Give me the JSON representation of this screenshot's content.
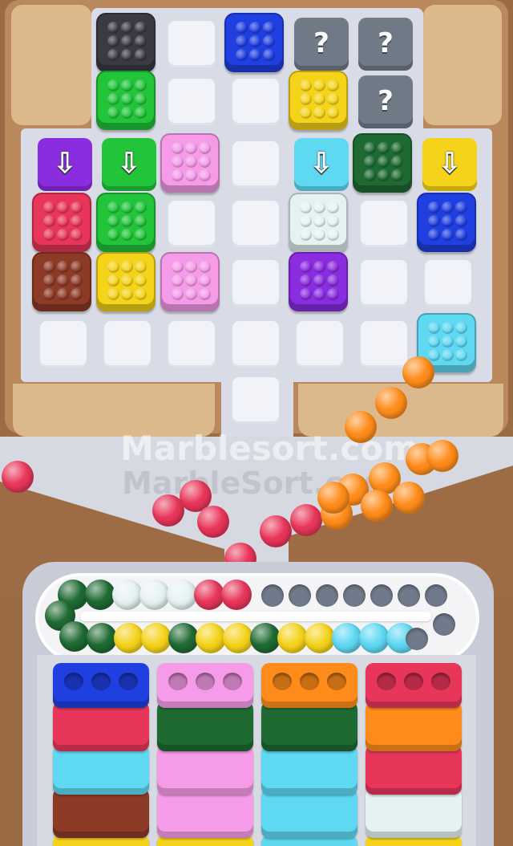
{
  "game_title": "Marble Sort",
  "watermark_primary": "Marblesort.com",
  "watermark_secondary": "MarbleSort.com",
  "hidden_block_symbol": "?",
  "release_arrow_symbol": "⇩",
  "colors": {
    "black": "#3a3a44",
    "blue": "#1f3fe0",
    "green": "#22c43a",
    "dark_green": "#1f6a33",
    "yellow": "#f5d31a",
    "pink": "#f59be8",
    "purple": "#8a2ce0",
    "red": "#e8365a",
    "brown": "#8d3a26",
    "white": "#e6f2f2",
    "cyan": "#5fd8f2",
    "orange": "#ff8c1a",
    "gray": "#6f7a86"
  },
  "board": {
    "rows": [
      [
        "black",
        "empty",
        "blue",
        "hidden",
        "hidden"
      ],
      [
        "green",
        "empty",
        "empty",
        "yellow",
        "hidden"
      ],
      [
        "arrow-purple",
        "arrow-green",
        "pink",
        "empty",
        "arrow-cyan",
        "dark_green",
        "arrow-yellow"
      ],
      [
        "red",
        "green",
        "empty",
        "empty",
        "white",
        "empty",
        "blue"
      ],
      [
        "brown",
        "yellow",
        "pink",
        "empty",
        "purple",
        "empty",
        "empty"
      ],
      [
        "empty",
        "empty",
        "empty",
        "empty",
        "empty",
        "empty",
        "cyan"
      ]
    ]
  },
  "conveyor": {
    "top_row": [
      "dark_green",
      "dark_green",
      "white",
      "white",
      "white",
      "red",
      "red"
    ],
    "bottom_row": [
      "dark_green",
      "yellow",
      "yellow",
      "dark_green",
      "yellow",
      "yellow",
      "dark_green",
      "yellow",
      "yellow",
      "cyan",
      "cyan",
      "cyan"
    ],
    "empty_slots": 7
  },
  "sort_boxes": [
    [
      "blue",
      "red",
      "cyan",
      "brown"
    ],
    [
      "pink",
      "dark_green",
      "pink",
      "pink"
    ],
    [
      "orange",
      "dark_green",
      "cyan",
      "cyan"
    ],
    [
      "red",
      "orange",
      "red",
      "white"
    ]
  ],
  "falling_marbles": {
    "red": 9,
    "orange": 11
  }
}
